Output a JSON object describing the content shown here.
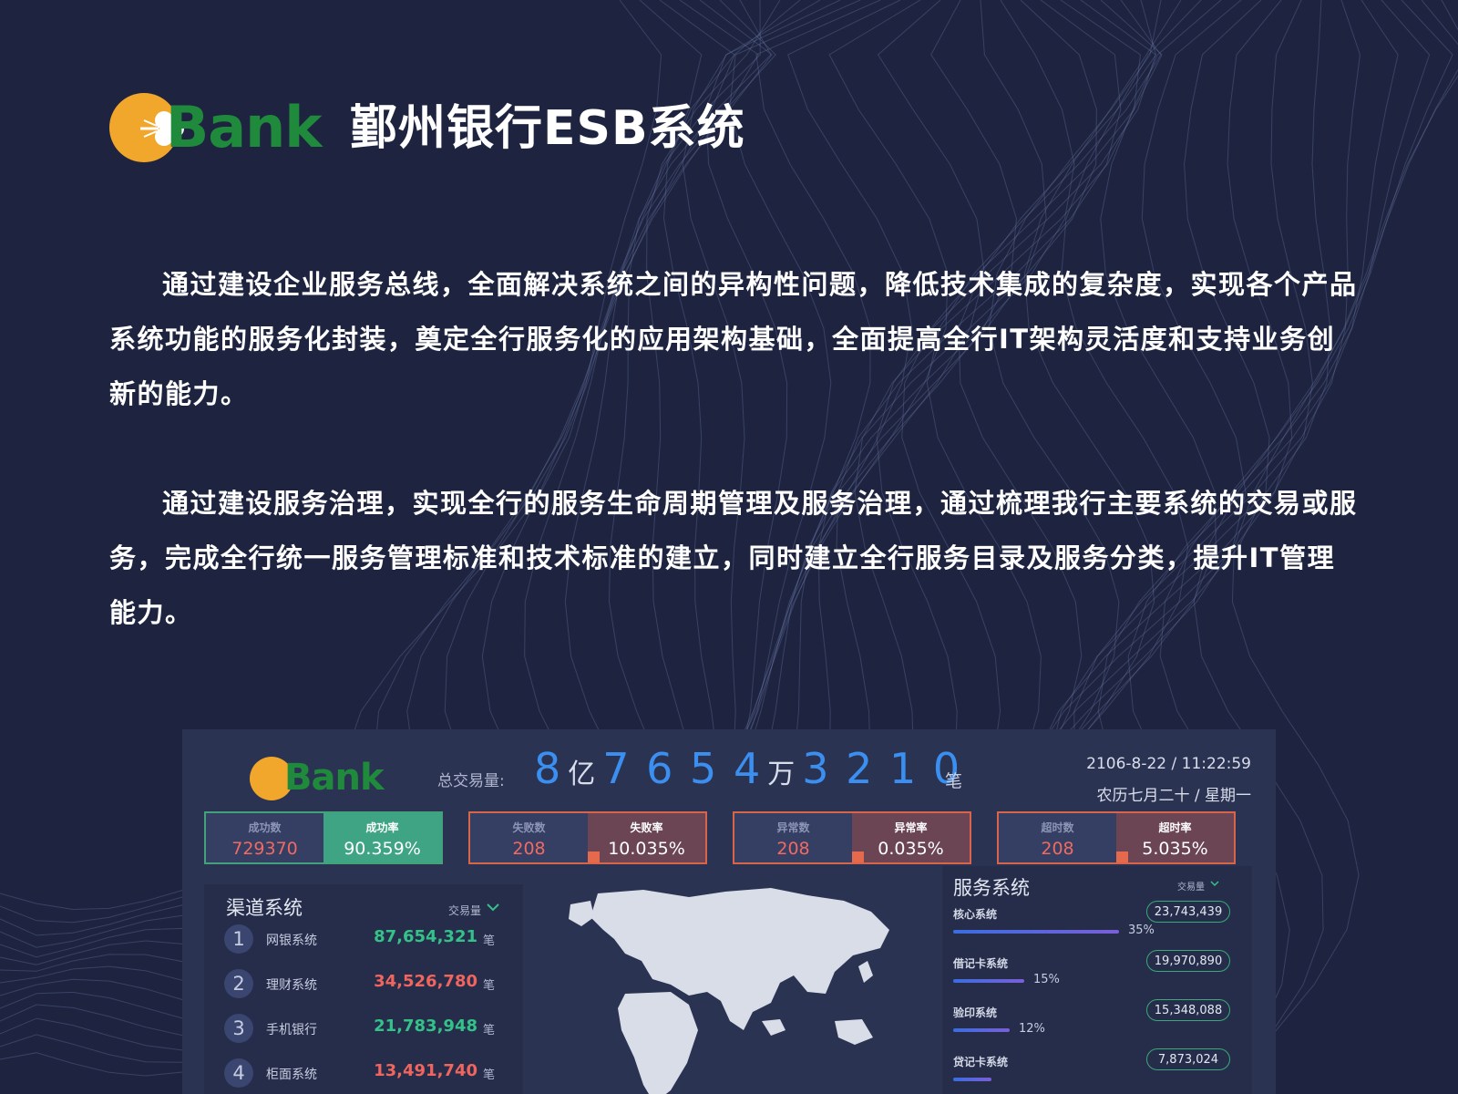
{
  "header": {
    "logo_text": "Bank",
    "title": "鄞州银行ESB系统"
  },
  "paragraphs": [
    "通过建设企业服务总线，全面解决系统之间的异构性问题，降低技术集成的复杂度，实现各个产品系统功能的服务化封装，奠定全行服务化的应用架构基础，全面提高全行IT架构灵活度和支持业务创新的能力。",
    "通过建设服务治理，实现全行的服务生命周期管理及服务治理，通过梳理我行主要系统的交易或服务，完成全行统一服务管理标准和技术标准的建立，同时建立全行服务目录及服务分类，提升IT管理能力。"
  ],
  "dashboard": {
    "logo_text": "Bank",
    "total_label": "总交易量:",
    "total": {
      "d1": "8",
      "u1": "亿",
      "d2": "7 6 5 4",
      "u2": "万",
      "d3": "3 2 1 0",
      "unit": "笔"
    },
    "datetime": "2106-8-22 / 11:22:59",
    "lunar": "农历七月二十 / 星期一",
    "stats": [
      {
        "count_label": "成功数",
        "count": "729370",
        "rate_label": "成功率",
        "rate": "90.359%",
        "style": "green"
      },
      {
        "count_label": "失败数",
        "count": "208",
        "rate_label": "失败率",
        "rate": "10.035%",
        "style": "red",
        "rate_fraction": 0.1
      },
      {
        "count_label": "异常数",
        "count": "208",
        "rate_label": "异常率",
        "rate": "0.035%",
        "style": "red",
        "rate_fraction": 0.1
      },
      {
        "count_label": "超时数",
        "count": "208",
        "rate_label": "超时率",
        "rate": "5.035%",
        "style": "red",
        "rate_fraction": 0.1
      }
    ],
    "channels": {
      "title": "渠道系统",
      "sort_label": "交易量",
      "unit": "笔",
      "rows": [
        {
          "rank": "1",
          "name": "网银系统",
          "value": "87,654,321",
          "color": "#35c28a"
        },
        {
          "rank": "2",
          "name": "理财系统",
          "value": "34,526,780",
          "color": "#f0655e"
        },
        {
          "rank": "3",
          "name": "手机银行",
          "value": "21,783,948",
          "color": "#35c28a"
        },
        {
          "rank": "4",
          "name": "柜面系统",
          "value": "13,491,740",
          "color": "#f0655e"
        }
      ]
    },
    "services": {
      "title": "服务系统",
      "sort_label": "交易量",
      "rows": [
        {
          "name": "核心系统",
          "value": "23,743,439",
          "pct": "35%",
          "fraction": 0.35
        },
        {
          "name": "借记卡系统",
          "value": "19,970,890",
          "pct": "15%",
          "fraction": 0.15
        },
        {
          "name": "验印系统",
          "value": "15,348,088",
          "pct": "12%",
          "fraction": 0.12
        },
        {
          "name": "贷记卡系统",
          "value": "7,873,024",
          "pct": "",
          "fraction": 0.08
        }
      ]
    }
  },
  "colors": {
    "background": "#1e2440",
    "logo_orange": "#f0a72b",
    "logo_green": "#1f8a3b",
    "accent_blue": "#3a8ff0",
    "success_green": "#3ea483",
    "alert_red": "#d8644a"
  }
}
